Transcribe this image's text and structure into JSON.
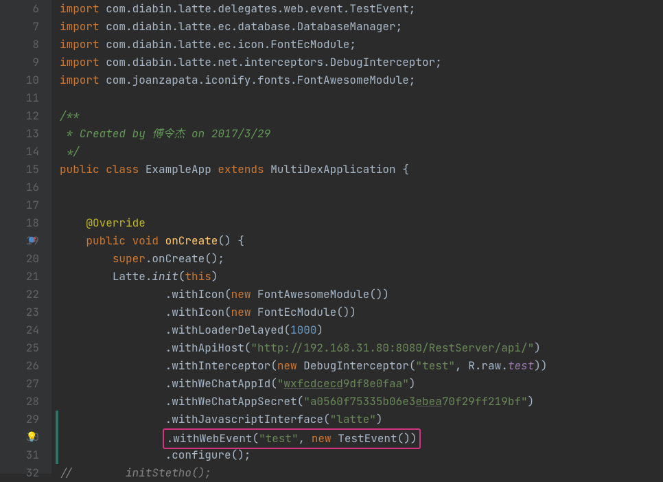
{
  "lines": [
    {
      "num": "6",
      "indent": 0,
      "tokens": [
        {
          "t": "kw",
          "v": "import "
        },
        {
          "t": "",
          "v": "com.diabin.latte.delegates.web.event.TestEvent;"
        }
      ]
    },
    {
      "num": "7",
      "indent": 0,
      "tokens": [
        {
          "t": "kw",
          "v": "import "
        },
        {
          "t": "",
          "v": "com.diabin.latte.ec.database.DatabaseManager;"
        }
      ]
    },
    {
      "num": "8",
      "indent": 0,
      "tokens": [
        {
          "t": "kw",
          "v": "import "
        },
        {
          "t": "",
          "v": "com.diabin.latte.ec.icon.FontEcModule;"
        }
      ]
    },
    {
      "num": "9",
      "indent": 0,
      "tokens": [
        {
          "t": "kw",
          "v": "import "
        },
        {
          "t": "",
          "v": "com.diabin.latte.net.interceptors.DebugInterceptor;"
        }
      ]
    },
    {
      "num": "10",
      "indent": 0,
      "tokens": [
        {
          "t": "kw",
          "v": "import "
        },
        {
          "t": "",
          "v": "com.joanzapata.iconify.fonts.FontAwesomeModule;"
        }
      ]
    },
    {
      "num": "11",
      "indent": 0,
      "tokens": []
    },
    {
      "num": "12",
      "indent": 0,
      "tokens": [
        {
          "t": "cmt-star",
          "v": "/**"
        }
      ]
    },
    {
      "num": "13",
      "indent": 0,
      "tokens": [
        {
          "t": "cmt-star",
          "v": " * Created by 傅令杰 on 2017/3/29"
        }
      ]
    },
    {
      "num": "14",
      "indent": 0,
      "tokens": [
        {
          "t": "cmt-star",
          "v": " */"
        }
      ]
    },
    {
      "num": "15",
      "indent": 0,
      "tokens": [
        {
          "t": "kw",
          "v": "public class "
        },
        {
          "t": "",
          "v": "ExampleApp "
        },
        {
          "t": "kw",
          "v": "extends "
        },
        {
          "t": "",
          "v": "MultiDexApplication {"
        }
      ]
    },
    {
      "num": "16",
      "indent": 0,
      "tokens": []
    },
    {
      "num": "17",
      "indent": 0,
      "tokens": []
    },
    {
      "num": "18",
      "indent": 4,
      "tokens": [
        {
          "t": "ann",
          "v": "@Override"
        }
      ]
    },
    {
      "num": "19",
      "indent": 4,
      "marker": "override",
      "tokens": [
        {
          "t": "kw",
          "v": "public void "
        },
        {
          "t": "method-decl",
          "v": "onCreate"
        },
        {
          "t": "",
          "v": "() {"
        }
      ]
    },
    {
      "num": "20",
      "indent": 8,
      "tokens": [
        {
          "t": "kw",
          "v": "super"
        },
        {
          "t": "",
          "v": ".onCreate();"
        }
      ]
    },
    {
      "num": "21",
      "indent": 8,
      "tokens": [
        {
          "t": "",
          "v": "Latte."
        },
        {
          "t": "static-call",
          "v": "init"
        },
        {
          "t": "",
          "v": "("
        },
        {
          "t": "this",
          "v": "this"
        },
        {
          "t": "",
          "v": ")"
        }
      ]
    },
    {
      "num": "22",
      "indent": 16,
      "tokens": [
        {
          "t": "",
          "v": ".withIcon("
        },
        {
          "t": "kw",
          "v": "new "
        },
        {
          "t": "",
          "v": "FontAwesomeModule())"
        }
      ]
    },
    {
      "num": "23",
      "indent": 16,
      "tokens": [
        {
          "t": "",
          "v": ".withIcon("
        },
        {
          "t": "kw",
          "v": "new "
        },
        {
          "t": "",
          "v": "FontEcModule())"
        }
      ]
    },
    {
      "num": "24",
      "indent": 16,
      "tokens": [
        {
          "t": "",
          "v": ".withLoaderDelayed("
        },
        {
          "t": "num",
          "v": "1000"
        },
        {
          "t": "",
          "v": ")"
        }
      ]
    },
    {
      "num": "25",
      "indent": 16,
      "tokens": [
        {
          "t": "",
          "v": ".withApiHost("
        },
        {
          "t": "str",
          "v": "\"http://192.168.31.80:8080/RestServer/api/\""
        },
        {
          "t": "",
          "v": ")"
        }
      ]
    },
    {
      "num": "26",
      "indent": 16,
      "tokens": [
        {
          "t": "",
          "v": ".withInterceptor("
        },
        {
          "t": "kw",
          "v": "new "
        },
        {
          "t": "",
          "v": "DebugInterceptor("
        },
        {
          "t": "str",
          "v": "\"test\""
        },
        {
          "t": "",
          "v": ", R.raw."
        },
        {
          "t": "field-access",
          "v": "test"
        },
        {
          "t": "",
          "v": "))"
        }
      ]
    },
    {
      "num": "27",
      "indent": 16,
      "tokens": [
        {
          "t": "",
          "v": ".withWeChatAppId("
        },
        {
          "t": "str",
          "v": "\""
        },
        {
          "t": "str underline",
          "v": "wxfcdcecd"
        },
        {
          "t": "str",
          "v": "9df8e0faa\""
        },
        {
          "t": "",
          "v": ")"
        }
      ]
    },
    {
      "num": "28",
      "indent": 16,
      "tokens": [
        {
          "t": "",
          "v": ".withWeChatAppSecret("
        },
        {
          "t": "str",
          "v": "\"a0560f75335b06e3"
        },
        {
          "t": "str underline",
          "v": "ebea"
        },
        {
          "t": "str",
          "v": "70f29ff219bf\""
        },
        {
          "t": "",
          "v": ")"
        }
      ]
    },
    {
      "num": "29",
      "indent": 16,
      "tokens": [
        {
          "t": "",
          "v": ".withJavascriptInterface("
        },
        {
          "t": "str",
          "v": "\"latte\""
        },
        {
          "t": "",
          "v": ")"
        }
      ]
    },
    {
      "num": "30",
      "indent": 16,
      "marker": "bulb",
      "highlight": true,
      "tokens": [
        {
          "t": "",
          "v": ".withWebEvent("
        },
        {
          "t": "str",
          "v": "\"test\""
        },
        {
          "t": "",
          "v": ", "
        },
        {
          "t": "kw",
          "v": "new "
        },
        {
          "t": "",
          "v": "TestEvent("
        },
        {
          "t": "caret-highlight",
          "v": ")"
        },
        {
          "t": "",
          "v": ")"
        }
      ]
    },
    {
      "num": "31",
      "indent": 16,
      "tokens": [
        {
          "t": "",
          "v": ".configure();"
        }
      ]
    },
    {
      "num": "32",
      "indent": 0,
      "tokens": [
        {
          "t": "cmt",
          "v": "//        initStetho();"
        }
      ]
    }
  ],
  "gutter_change_segments": [
    {
      "from": 23,
      "to": 25
    }
  ]
}
